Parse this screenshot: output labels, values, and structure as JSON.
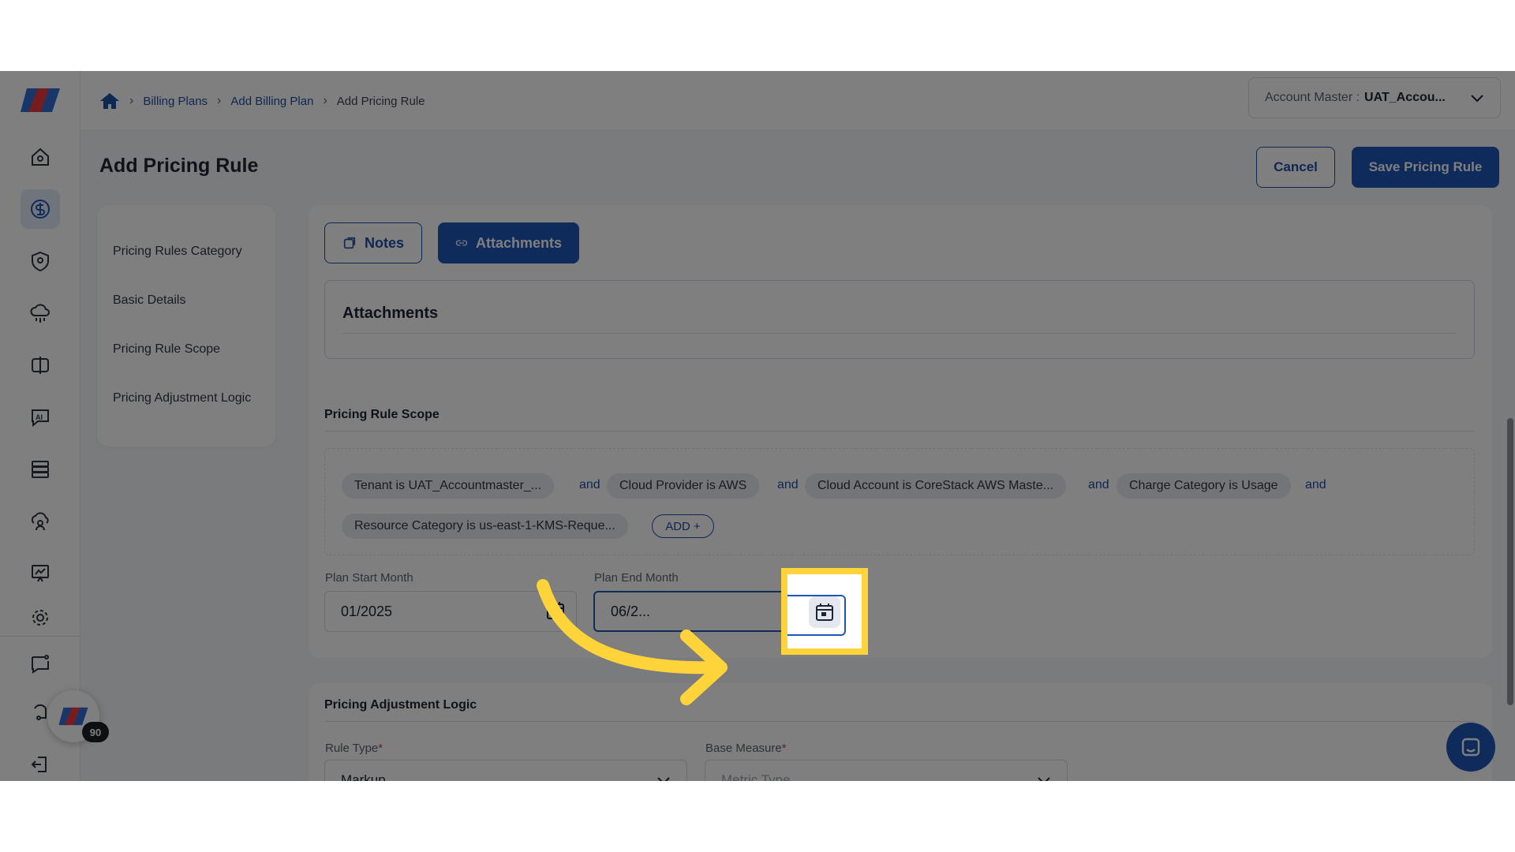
{
  "colors": {
    "accent": "#1e56b8",
    "highlight": "#ffd43b",
    "chip_bg": "#e6ebf3"
  },
  "breadcrumb": {
    "home_icon": "home-icon",
    "items": [
      "Billing Plans",
      "Add Billing Plan",
      "Add Pricing Rule"
    ]
  },
  "account": {
    "label": "Account Master :",
    "value": "UAT_Accou..."
  },
  "header": {
    "title": "Add Pricing Rule",
    "cancel_label": "Cancel",
    "save_label": "Save Pricing Rule"
  },
  "left_menu": {
    "items": [
      "Pricing Rules Category",
      "Basic Details",
      "Pricing Rule Scope",
      "Pricing Adjustment Logic"
    ]
  },
  "tabs": {
    "notes_label": "Notes",
    "attachments_label": "Attachments"
  },
  "attachments": {
    "title": "Attachments"
  },
  "scope": {
    "title": "Pricing Rule Scope",
    "conditions": [
      "Tenant is UAT_Accountmaster_...",
      "Cloud Provider is AWS",
      "Cloud Account is CoreStack AWS Maste...",
      "Charge Category is Usage",
      "Resource Category is us-east-1-KMS-Reque..."
    ],
    "connector": "and",
    "add_label": "ADD +",
    "plan_start": {
      "label": "Plan Start Month",
      "value": "01/2025"
    },
    "plan_end": {
      "label": "Plan End Month",
      "value": "06/2..."
    }
  },
  "adjustment": {
    "title": "Pricing Adjustment Logic",
    "rule_type": {
      "label": "Rule Type",
      "value": "Markup"
    },
    "base_measure": {
      "label": "Base Measure",
      "placeholder": "Metric Type"
    }
  },
  "notification_count": "90"
}
